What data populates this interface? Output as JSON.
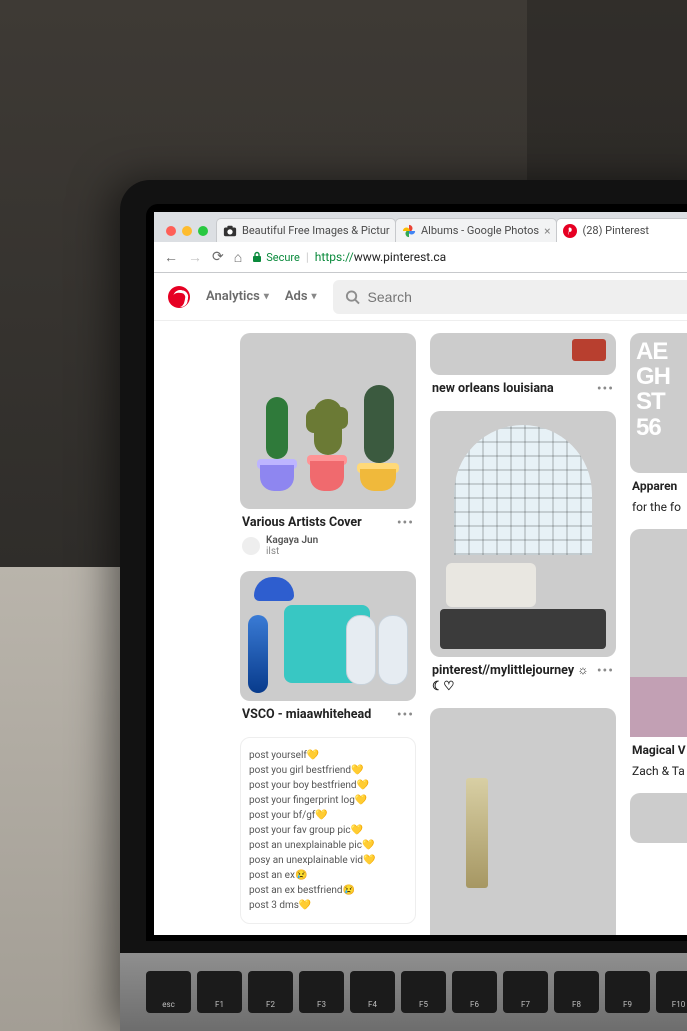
{
  "window": {
    "tabs": [
      {
        "title": "Beautiful Free Images & Pictur",
        "favicon": "camera"
      },
      {
        "title": "Albums - Google Photos",
        "favicon": "gphotos"
      },
      {
        "title": "(28) Pinterest",
        "favicon": "pinterest"
      }
    ],
    "active_tab_index": 2,
    "toolbar": {
      "secure_label": "Secure",
      "url_scheme": "https://",
      "url_host": "www.pinterest.ca"
    }
  },
  "header": {
    "nav": [
      {
        "label": "Analytics"
      },
      {
        "label": "Ads"
      }
    ],
    "search_placeholder": "Search"
  },
  "feed": {
    "col1": [
      {
        "kind": "art",
        "title": "Various Artists Cover",
        "author": "Kagaya Jun",
        "author_sub": "ilst"
      },
      {
        "kind": "flatlay",
        "title": "VSCO - miaawhitehead"
      },
      {
        "kind": "textpost",
        "lines": [
          "post yourself💛",
          "post you girl bestfriend💛",
          "post your boy bestfriend💛",
          "post your fingerprint log💛",
          "post your bf/gf💛",
          "post your fav group pic💛",
          "post an unexplainable pic💛",
          "posy an unexplainable vid💛",
          "post an ex😢",
          "post an ex bestfriend😢",
          "post 3 dms💛"
        ]
      }
    ],
    "col2": [
      {
        "kind": "nol",
        "title": "new orleans louisiana"
      },
      {
        "kind": "loft",
        "title": "pinterest//mylittlejourney ☼ ☾♡"
      },
      {
        "kind": "marble"
      }
    ],
    "col3": [
      {
        "kind": "typo",
        "lines": [
          "AE",
          "GH",
          "ST",
          "56"
        ],
        "title": "Apparen",
        "subtitle": "for the fo"
      },
      {
        "kind": "garden",
        "title": "Magical V",
        "subtitle": "Zach & Ta"
      },
      {
        "kind": "mini"
      }
    ]
  },
  "keyboard": {
    "keys": [
      "esc",
      "F1",
      "F2",
      "F3",
      "F4",
      "F5",
      "F6",
      "F7",
      "F8",
      "F9",
      "F10"
    ]
  }
}
